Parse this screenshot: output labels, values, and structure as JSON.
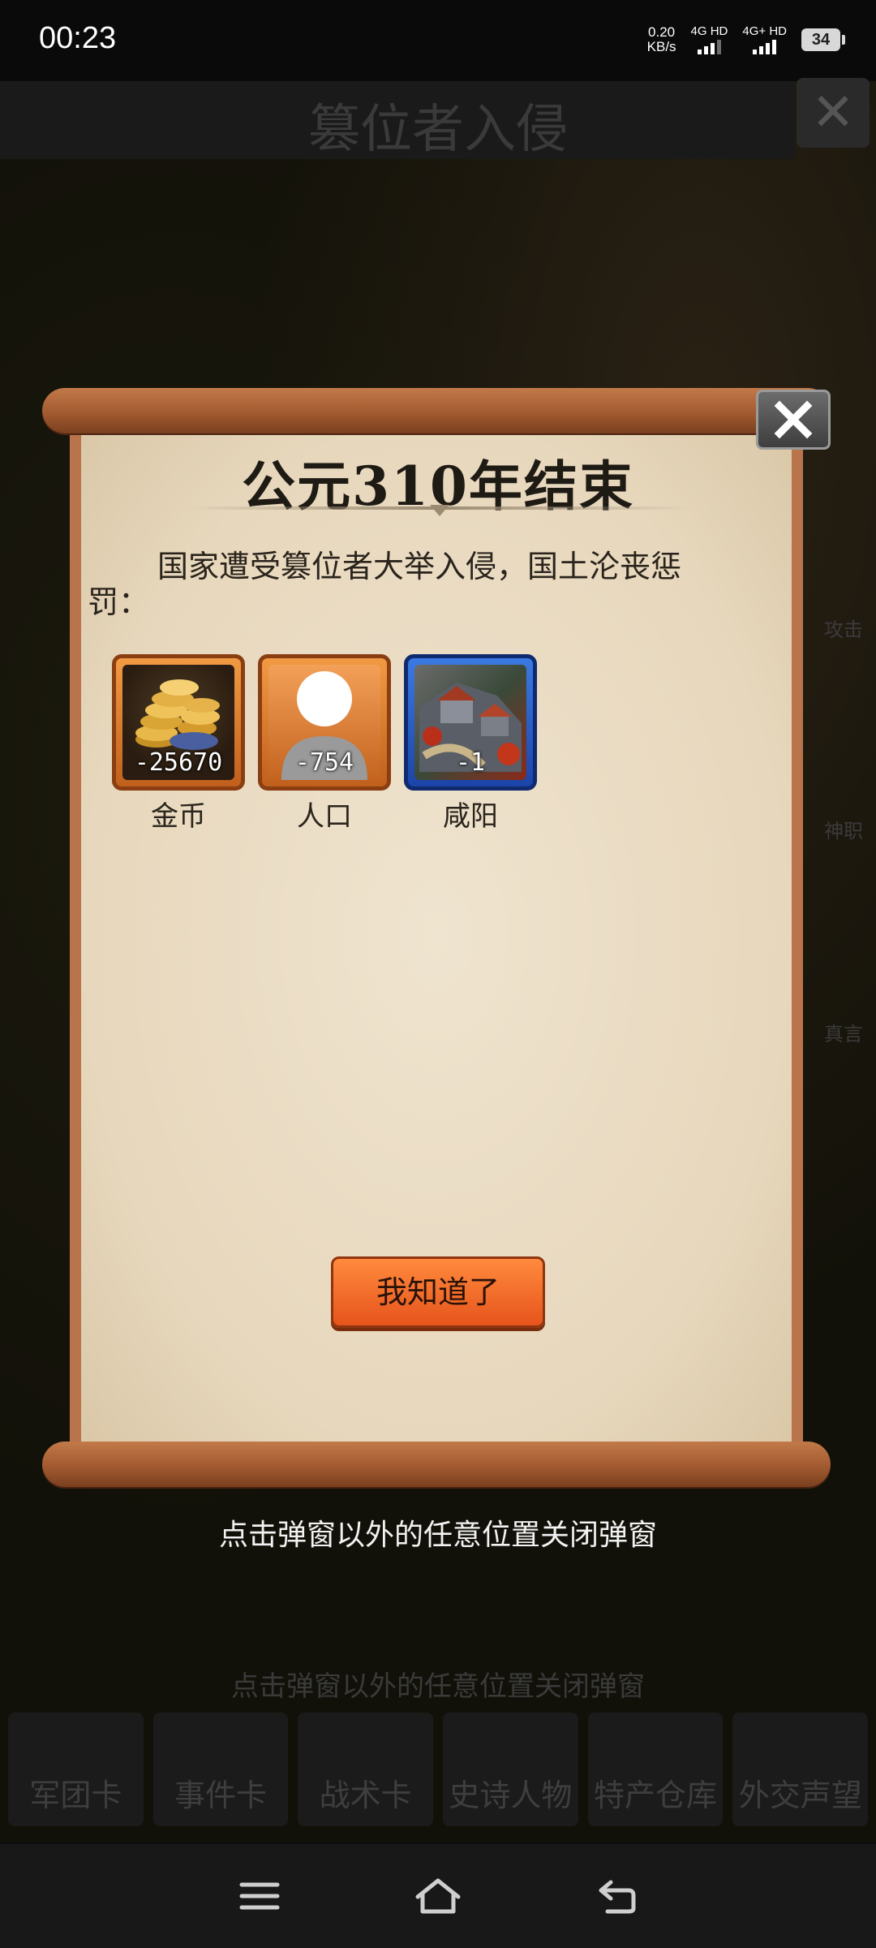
{
  "status_bar": {
    "time": "00:23",
    "speed_value": "0.20",
    "speed_unit": "KB/s",
    "network1": "4G HD",
    "network2": "4G+ HD",
    "battery": "34"
  },
  "background": {
    "title": "篡位者入侵",
    "hint": "点击弹窗以外的任意位置关闭弹窗",
    "side_labels": [
      "攻击",
      "神职",
      "真言"
    ],
    "tabs": [
      "军团卡",
      "事件卡",
      "战术卡",
      "史诗人物",
      "特产仓库",
      "外交声望"
    ]
  },
  "dialog": {
    "title": "公元310年结束",
    "message": "国家遭受篡位者大举入侵，国土沦丧惩罚：",
    "penalties": [
      {
        "label": "金币",
        "amount": "-25670",
        "icon": "gold-coins-icon"
      },
      {
        "label": "人口",
        "amount": "-754",
        "icon": "population-icon"
      },
      {
        "label": "咸阳",
        "amount": "-1",
        "icon": "city-icon"
      }
    ],
    "confirm_label": "我知道了",
    "close_hint": "点击弹窗以外的任意位置关闭弹窗"
  }
}
